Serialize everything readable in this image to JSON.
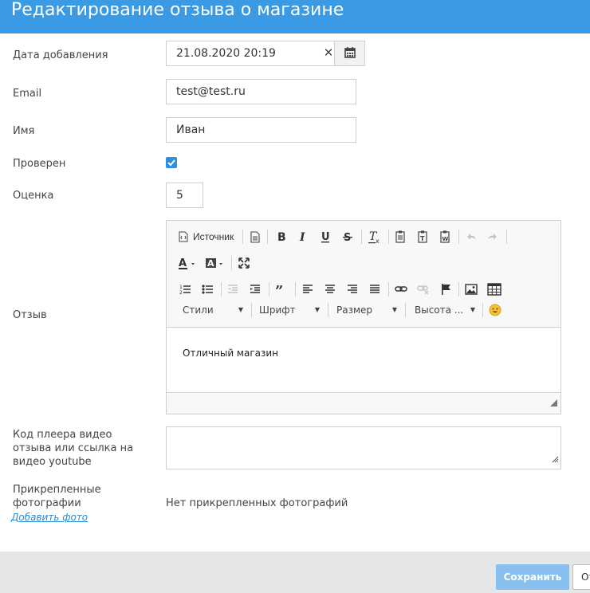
{
  "header": {
    "title": "Редактирование отзыва о магазине"
  },
  "form": {
    "date": {
      "label": "Дата добавления",
      "value": "21.08.2020 20:19",
      "clear_glyph": "✕"
    },
    "email": {
      "label": "Email",
      "value": "test@test.ru"
    },
    "name": {
      "label": "Имя",
      "value": "Иван"
    },
    "verified": {
      "label": "Проверен",
      "checked": true
    },
    "rating": {
      "label": "Оценка",
      "value": "5"
    },
    "review": {
      "label": "Отзыв",
      "content": "Отличный магазин",
      "toolbar": {
        "source_label": "Источник",
        "styles_label": "Стили",
        "font_label": "Шрифт",
        "size_label": "Размер",
        "height_label": "Высота ..."
      }
    },
    "video": {
      "label": "Код плеера видео отзыва или ссылка на видео youtube",
      "value": ""
    },
    "photos": {
      "label": "Прикрепленные фотографии",
      "empty_text": "Нет прикрепленных фотографий",
      "add_link": "Добавить фото"
    }
  },
  "footer": {
    "save_label": "Сохранить",
    "cancel_label": "Отмена"
  },
  "colors": {
    "header": "#3a9be4",
    "accent": "#2e8fe0",
    "save_button": "#87c0ee",
    "footer": "#e5e6e8"
  }
}
